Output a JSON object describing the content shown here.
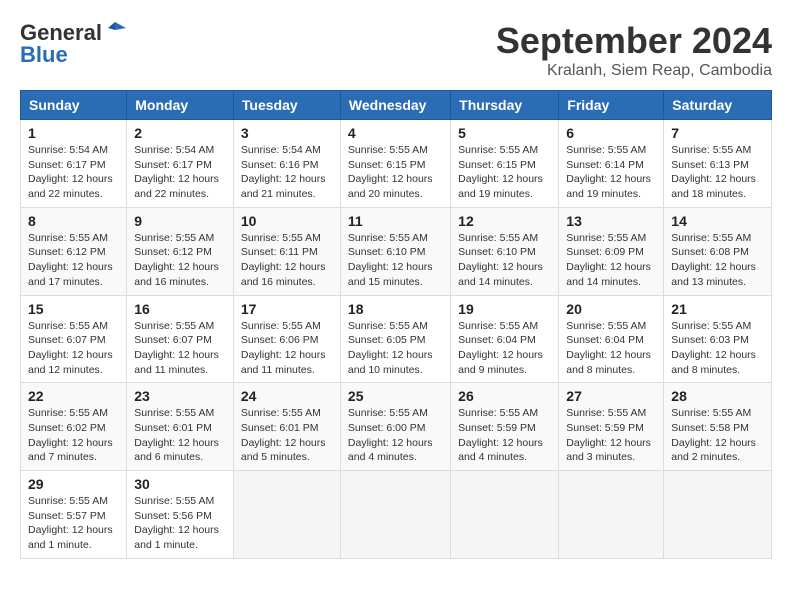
{
  "header": {
    "logo_line1": "General",
    "logo_line2": "Blue",
    "month": "September 2024",
    "location": "Kralanh, Siem Reap, Cambodia"
  },
  "weekdays": [
    "Sunday",
    "Monday",
    "Tuesday",
    "Wednesday",
    "Thursday",
    "Friday",
    "Saturday"
  ],
  "weeks": [
    [
      {
        "day": "1",
        "info": "Sunrise: 5:54 AM\nSunset: 6:17 PM\nDaylight: 12 hours\nand 22 minutes."
      },
      {
        "day": "2",
        "info": "Sunrise: 5:54 AM\nSunset: 6:17 PM\nDaylight: 12 hours\nand 22 minutes."
      },
      {
        "day": "3",
        "info": "Sunrise: 5:54 AM\nSunset: 6:16 PM\nDaylight: 12 hours\nand 21 minutes."
      },
      {
        "day": "4",
        "info": "Sunrise: 5:55 AM\nSunset: 6:15 PM\nDaylight: 12 hours\nand 20 minutes."
      },
      {
        "day": "5",
        "info": "Sunrise: 5:55 AM\nSunset: 6:15 PM\nDaylight: 12 hours\nand 19 minutes."
      },
      {
        "day": "6",
        "info": "Sunrise: 5:55 AM\nSunset: 6:14 PM\nDaylight: 12 hours\nand 19 minutes."
      },
      {
        "day": "7",
        "info": "Sunrise: 5:55 AM\nSunset: 6:13 PM\nDaylight: 12 hours\nand 18 minutes."
      }
    ],
    [
      {
        "day": "8",
        "info": "Sunrise: 5:55 AM\nSunset: 6:12 PM\nDaylight: 12 hours\nand 17 minutes."
      },
      {
        "day": "9",
        "info": "Sunrise: 5:55 AM\nSunset: 6:12 PM\nDaylight: 12 hours\nand 16 minutes."
      },
      {
        "day": "10",
        "info": "Sunrise: 5:55 AM\nSunset: 6:11 PM\nDaylight: 12 hours\nand 16 minutes."
      },
      {
        "day": "11",
        "info": "Sunrise: 5:55 AM\nSunset: 6:10 PM\nDaylight: 12 hours\nand 15 minutes."
      },
      {
        "day": "12",
        "info": "Sunrise: 5:55 AM\nSunset: 6:10 PM\nDaylight: 12 hours\nand 14 minutes."
      },
      {
        "day": "13",
        "info": "Sunrise: 5:55 AM\nSunset: 6:09 PM\nDaylight: 12 hours\nand 14 minutes."
      },
      {
        "day": "14",
        "info": "Sunrise: 5:55 AM\nSunset: 6:08 PM\nDaylight: 12 hours\nand 13 minutes."
      }
    ],
    [
      {
        "day": "15",
        "info": "Sunrise: 5:55 AM\nSunset: 6:07 PM\nDaylight: 12 hours\nand 12 minutes."
      },
      {
        "day": "16",
        "info": "Sunrise: 5:55 AM\nSunset: 6:07 PM\nDaylight: 12 hours\nand 11 minutes."
      },
      {
        "day": "17",
        "info": "Sunrise: 5:55 AM\nSunset: 6:06 PM\nDaylight: 12 hours\nand 11 minutes."
      },
      {
        "day": "18",
        "info": "Sunrise: 5:55 AM\nSunset: 6:05 PM\nDaylight: 12 hours\nand 10 minutes."
      },
      {
        "day": "19",
        "info": "Sunrise: 5:55 AM\nSunset: 6:04 PM\nDaylight: 12 hours\nand 9 minutes."
      },
      {
        "day": "20",
        "info": "Sunrise: 5:55 AM\nSunset: 6:04 PM\nDaylight: 12 hours\nand 8 minutes."
      },
      {
        "day": "21",
        "info": "Sunrise: 5:55 AM\nSunset: 6:03 PM\nDaylight: 12 hours\nand 8 minutes."
      }
    ],
    [
      {
        "day": "22",
        "info": "Sunrise: 5:55 AM\nSunset: 6:02 PM\nDaylight: 12 hours\nand 7 minutes."
      },
      {
        "day": "23",
        "info": "Sunrise: 5:55 AM\nSunset: 6:01 PM\nDaylight: 12 hours\nand 6 minutes."
      },
      {
        "day": "24",
        "info": "Sunrise: 5:55 AM\nSunset: 6:01 PM\nDaylight: 12 hours\nand 5 minutes."
      },
      {
        "day": "25",
        "info": "Sunrise: 5:55 AM\nSunset: 6:00 PM\nDaylight: 12 hours\nand 4 minutes."
      },
      {
        "day": "26",
        "info": "Sunrise: 5:55 AM\nSunset: 5:59 PM\nDaylight: 12 hours\nand 4 minutes."
      },
      {
        "day": "27",
        "info": "Sunrise: 5:55 AM\nSunset: 5:59 PM\nDaylight: 12 hours\nand 3 minutes."
      },
      {
        "day": "28",
        "info": "Sunrise: 5:55 AM\nSunset: 5:58 PM\nDaylight: 12 hours\nand 2 minutes."
      }
    ],
    [
      {
        "day": "29",
        "info": "Sunrise: 5:55 AM\nSunset: 5:57 PM\nDaylight: 12 hours\nand 1 minute."
      },
      {
        "day": "30",
        "info": "Sunrise: 5:55 AM\nSunset: 5:56 PM\nDaylight: 12 hours\nand 1 minute."
      },
      {
        "day": "",
        "info": ""
      },
      {
        "day": "",
        "info": ""
      },
      {
        "day": "",
        "info": ""
      },
      {
        "day": "",
        "info": ""
      },
      {
        "day": "",
        "info": ""
      }
    ]
  ]
}
